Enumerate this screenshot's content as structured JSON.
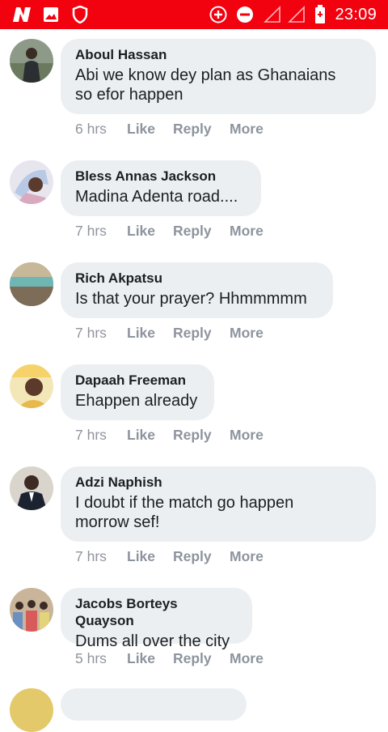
{
  "status_bar": {
    "time": "23:09",
    "icons": [
      "n-app-icon",
      "image-icon",
      "shield-icon",
      "add-circle-icon",
      "do-not-disturb-icon",
      "no-signal-icon",
      "no-signal-icon",
      "battery-icon"
    ],
    "background_color": "#f2010f"
  },
  "actions": {
    "like": "Like",
    "reply": "Reply",
    "more": "More"
  },
  "comments": [
    {
      "author": "Aboul Hassan",
      "lines": [
        "Abi we know dey plan as Ghanaians",
        "so efor happen"
      ],
      "time": "6 hrs"
    },
    {
      "author": "Bless Annas Jackson",
      "lines": [
        "Madina Adenta road...."
      ],
      "time": "7 hrs"
    },
    {
      "author": "Rich Akpatsu",
      "lines": [
        "Is that your prayer? Hhmmmmm"
      ],
      "time": "7 hrs"
    },
    {
      "author": "Dapaah Freeman",
      "lines": [
        "Ehappen already"
      ],
      "time": "7 hrs"
    },
    {
      "author": "Adzi Naphish",
      "lines": [
        "I doubt if the match go happen",
        "morrow sef!"
      ],
      "time": "7 hrs"
    },
    {
      "author": "Jacobs Borteys Quayson",
      "lines": [
        "Dums all over the city"
      ],
      "time": "5 hrs"
    }
  ]
}
